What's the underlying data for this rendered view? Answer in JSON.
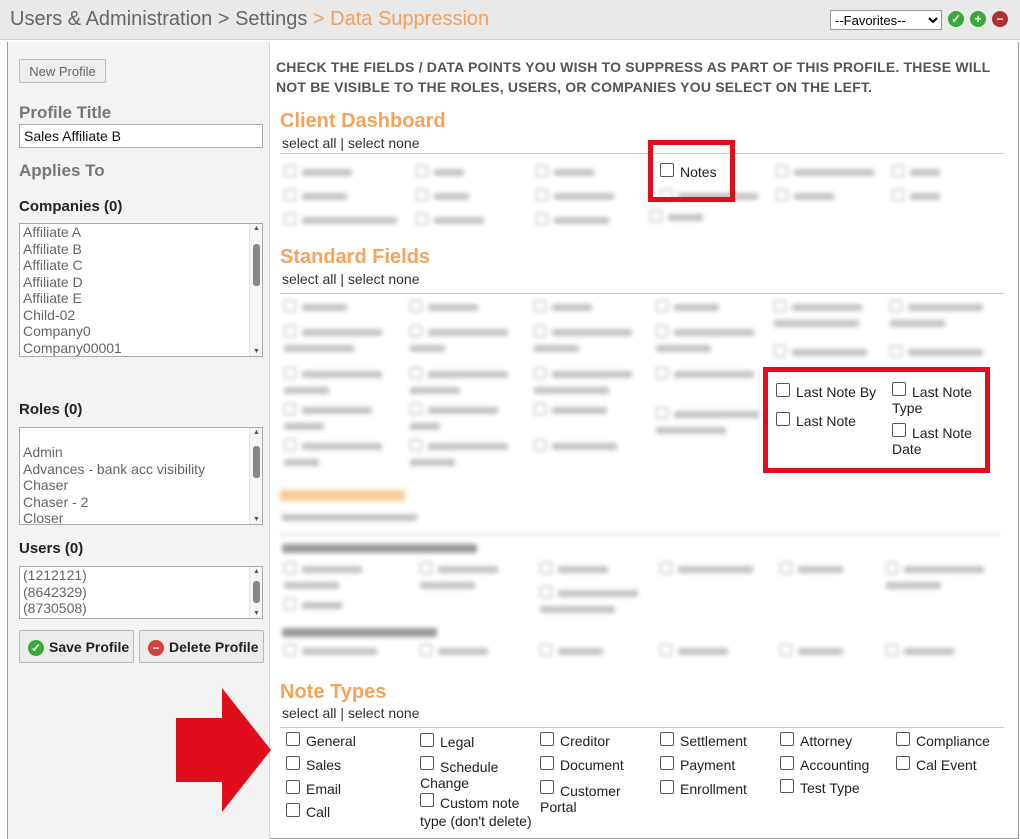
{
  "breadcrumb": {
    "part1": "Users & Administration",
    "sep1": " > ",
    "part2": "Settings",
    "sep2": " > ",
    "part3": "Data Suppression"
  },
  "favorites": {
    "selected": "--Favorites--"
  },
  "sidebar": {
    "new_profile": "New Profile",
    "profile_title_label": "Profile Title",
    "profile_title_value": "Sales Affiliate B",
    "applies_to": "Applies To",
    "companies_label": "Companies (0)",
    "companies": [
      "Affiliate A",
      "Affiliate B",
      "Affiliate C",
      "Affiliate D",
      "Affiliate E",
      "Child-02",
      "Company0",
      "Company00001"
    ],
    "roles_label": "Roles (0)",
    "roles": [
      "Admin",
      "Advances - bank acc visibility",
      "Chaser",
      "Chaser - 2",
      "Closer"
    ],
    "users_label": "Users (0)",
    "users": [
      "(1212121)",
      "(8642329)",
      "(8730508)"
    ],
    "save_profile": "Save Profile",
    "delete_profile": "Delete Profile"
  },
  "instructions": "CHECK THE FIELDS / DATA POINTS YOU WISH TO SUPPRESS AS PART OF THIS PROFILE. THESE WILL NOT BE VISIBLE TO THE ROLES, USERS, OR COMPANIES YOU SELECT ON THE LEFT.",
  "select_all": "select all",
  "select_sep": " | ",
  "select_none": "select none",
  "client_dashboard": {
    "title": "Client Dashboard",
    "notes": "Notes"
  },
  "standard_fields": {
    "title": "Standard Fields",
    "last_note_by": "Last Note By",
    "last_note_type": "Last Note Type",
    "last_note": "Last Note",
    "last_note_date": "Last Note Date"
  },
  "note_types": {
    "title": "Note Types",
    "items": [
      "General",
      "Legal",
      "Creditor",
      "Settlement",
      "Attorney",
      "Compliance",
      "Sales",
      "Schedule Change",
      "Document",
      "Payment",
      "Accounting",
      "Cal Event",
      "Email",
      "Custom note type (don't delete)",
      "Customer Portal",
      "Enrollment",
      "Test Type",
      "Call"
    ]
  },
  "colors": {
    "accent": "#f7a35c",
    "highlight": "#e00d1c",
    "ok_green": "#3aa83a",
    "danger_red": "#d84040"
  },
  "icons": {
    "confirm": "check-circle-icon",
    "add": "plus-circle-icon",
    "remove": "minus-circle-icon",
    "arrow": "right-arrow-icon"
  }
}
